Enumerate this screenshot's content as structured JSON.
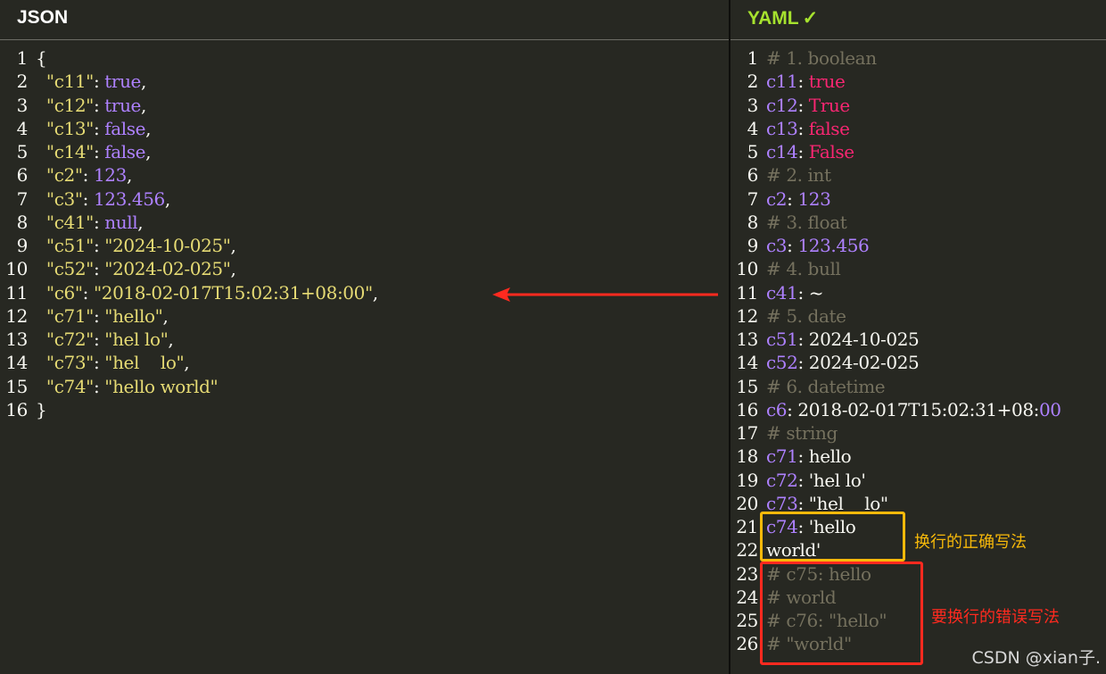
{
  "left_panel": {
    "title": "JSON",
    "lines": [
      {
        "n": "1",
        "html": "{"
      },
      {
        "n": "2",
        "html": "  <span class=\"s\">\"c11\"</span>: <span class=\"b\">true</span>,"
      },
      {
        "n": "3",
        "html": "  <span class=\"s\">\"c12\"</span>: <span class=\"b\">true</span>,"
      },
      {
        "n": "4",
        "html": "  <span class=\"s\">\"c13\"</span>: <span class=\"b\">false</span>,"
      },
      {
        "n": "5",
        "html": "  <span class=\"s\">\"c14\"</span>: <span class=\"b\">false</span>,"
      },
      {
        "n": "6",
        "html": "  <span class=\"s\">\"c2\"</span>: <span class=\"b\">123</span>,"
      },
      {
        "n": "7",
        "html": "  <span class=\"s\">\"c3\"</span>: <span class=\"b\">123.456</span>,"
      },
      {
        "n": "8",
        "html": "  <span class=\"s\">\"c41\"</span>: <span class=\"b\">null</span>,"
      },
      {
        "n": "9",
        "html": "  <span class=\"s\">\"c51\"</span>: <span class=\"s\">\"2024-10-025\"</span>,"
      },
      {
        "n": "10",
        "html": "  <span class=\"s\">\"c52\"</span>: <span class=\"s\">\"2024-02-025\"</span>,"
      },
      {
        "n": "11",
        "html": "  <span class=\"s\">\"c6\"</span>: <span class=\"s\">\"2018-02-017T15:02:31+08:00\"</span>,"
      },
      {
        "n": "12",
        "html": "  <span class=\"s\">\"c71\"</span>: <span class=\"s\">\"hello\"</span>,"
      },
      {
        "n": "13",
        "html": "  <span class=\"s\">\"c72\"</span>: <span class=\"s\">\"hel lo\"</span>,"
      },
      {
        "n": "14",
        "html": "  <span class=\"s\">\"c73\"</span>: <span class=\"s\">\"hel    lo\"</span>,"
      },
      {
        "n": "15",
        "html": "  <span class=\"s\">\"c74\"</span>: <span class=\"s\">\"hello world\"</span>"
      },
      {
        "n": "16",
        "html": "}"
      }
    ]
  },
  "right_panel": {
    "title": "YAML",
    "status_icon": "check-icon",
    "status_glyph": "✓",
    "lines": [
      {
        "n": "1",
        "html": "<span class=\"c\"># 1. boolean</span>"
      },
      {
        "n": "2",
        "html": "<span class=\"k\">c11</span>: <span class=\"r\">true</span>"
      },
      {
        "n": "3",
        "html": "<span class=\"k\">c12</span>: <span class=\"r\">True</span>"
      },
      {
        "n": "4",
        "html": "<span class=\"k\">c13</span>: <span class=\"r\">false</span>"
      },
      {
        "n": "5",
        "html": "<span class=\"k\">c14</span>: <span class=\"r\">False</span>"
      },
      {
        "n": "6",
        "html": "<span class=\"c\"># 2. int</span>"
      },
      {
        "n": "7",
        "html": "<span class=\"k\">c2</span>: <span class=\"b\">123</span>"
      },
      {
        "n": "8",
        "html": "<span class=\"c\"># 3. float</span>"
      },
      {
        "n": "9",
        "html": "<span class=\"k\">c3</span>: <span class=\"b\">123.456</span>"
      },
      {
        "n": "10",
        "html": "<span class=\"c\"># 4. bull</span>"
      },
      {
        "n": "11",
        "html": "<span class=\"k\">c41</span>: ~"
      },
      {
        "n": "12",
        "html": "<span class=\"c\"># 5. date</span>"
      },
      {
        "n": "13",
        "html": "<span class=\"k\">c51</span>: 2024-10-025"
      },
      {
        "n": "14",
        "html": "<span class=\"k\">c52</span>: 2024-02-025"
      },
      {
        "n": "15",
        "html": "<span class=\"c\"># 6. datetime</span>"
      },
      {
        "n": "16",
        "html": "<span class=\"k\">c6</span>: 2018-02-017T15:02:31+08:<span class=\"b\">00</span>"
      },
      {
        "n": "17",
        "html": "<span class=\"c\"># string</span>"
      },
      {
        "n": "18",
        "html": "<span class=\"k\">c71</span>: hello"
      },
      {
        "n": "19",
        "html": "<span class=\"k\">c72</span>: 'hel lo'"
      },
      {
        "n": "20",
        "html": "<span class=\"k\">c73</span>: \"hel    lo\""
      },
      {
        "n": "21",
        "html": "<span class=\"k\">c74</span>: 'hello"
      },
      {
        "n": "22",
        "html": "world'"
      },
      {
        "n": "23",
        "html": "<span class=\"c\"># c75: hello</span>"
      },
      {
        "n": "24",
        "html": "<span class=\"c\"># world</span>"
      },
      {
        "n": "25",
        "html": "<span class=\"c\"># c76: \"hello\"</span>"
      },
      {
        "n": "26",
        "html": "<span class=\"c\"># \"world\"</span>"
      }
    ]
  },
  "annotations": {
    "correct_note": "换行的正确写法",
    "wrong_note": "要换行的错误写法",
    "arrow_icon": "left-arrow-icon",
    "arrow_color": "#ff2a1f",
    "correct_color": "#f7b90a"
  },
  "watermark": "CSDN @xian子."
}
